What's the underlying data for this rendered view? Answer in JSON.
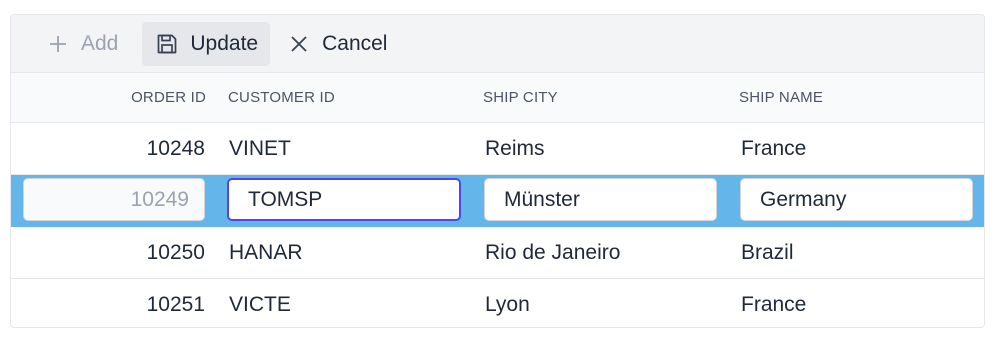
{
  "toolbar": {
    "add_label": "Add",
    "update_label": "Update",
    "cancel_label": "Cancel"
  },
  "columns": {
    "order_id": "ORDER ID",
    "customer_id": "CUSTOMER ID",
    "ship_city": "SHIP CITY",
    "ship_name": "SHIP NAME"
  },
  "rows": [
    {
      "order_id": "10248",
      "customer_id": "VINET",
      "ship_city": "Reims",
      "ship_name": "France"
    },
    {
      "order_id": "10249",
      "customer_id": "TOMSP",
      "ship_city": "Münster",
      "ship_name": "Germany"
    },
    {
      "order_id": "10250",
      "customer_id": "HANAR",
      "ship_city": "Rio de Janeiro",
      "ship_name": "Brazil"
    },
    {
      "order_id": "10251",
      "customer_id": "VICTE",
      "ship_city": "Lyon",
      "ship_name": "France"
    }
  ],
  "colors": {
    "edit_row_bg": "#64b5ea",
    "focus_border": "#4f46e5"
  },
  "icons": {
    "add": "plus-icon",
    "update": "save-icon",
    "cancel": "close-icon"
  }
}
